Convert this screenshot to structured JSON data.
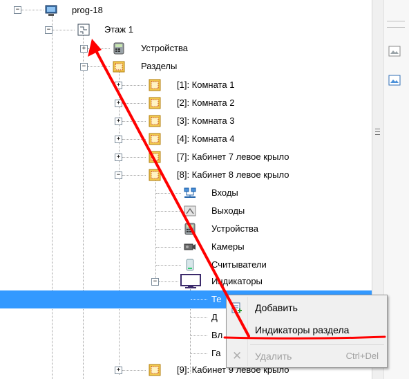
{
  "tree": {
    "root_label": "prog-18",
    "floor_label": "Этаж 1",
    "devices_label": "Устройства",
    "sections_label": "Разделы",
    "rooms": [
      "[1]: Комната 1",
      "[2]: Комната 2",
      "[3]: Комната 3",
      "[4]: Комната 4",
      "[7]: Кабинет 7 левое крыло",
      "[8]: Кабинет 8 левое крыло"
    ],
    "children": {
      "inputs": "Входы",
      "outputs": "Выходы",
      "devices": "Устройства",
      "cameras": "Камеры",
      "readers": "Считыватели",
      "indicators": "Индикаторы"
    },
    "indicator_children": [
      "Те",
      "Д",
      "Вл",
      "Га"
    ],
    "last_room": "[9]: Кабинет 9 левое крыло",
    "expanders": {
      "minus": "−",
      "plus": "+"
    }
  },
  "context_menu": {
    "add_label": "Добавить",
    "section_indicators_label": "Индикаторы раздела",
    "delete_label": "Удалить",
    "delete_shortcut": "Ctrl+Del"
  },
  "colors": {
    "selection": "#3399ff",
    "annotation": "#ff0000"
  }
}
